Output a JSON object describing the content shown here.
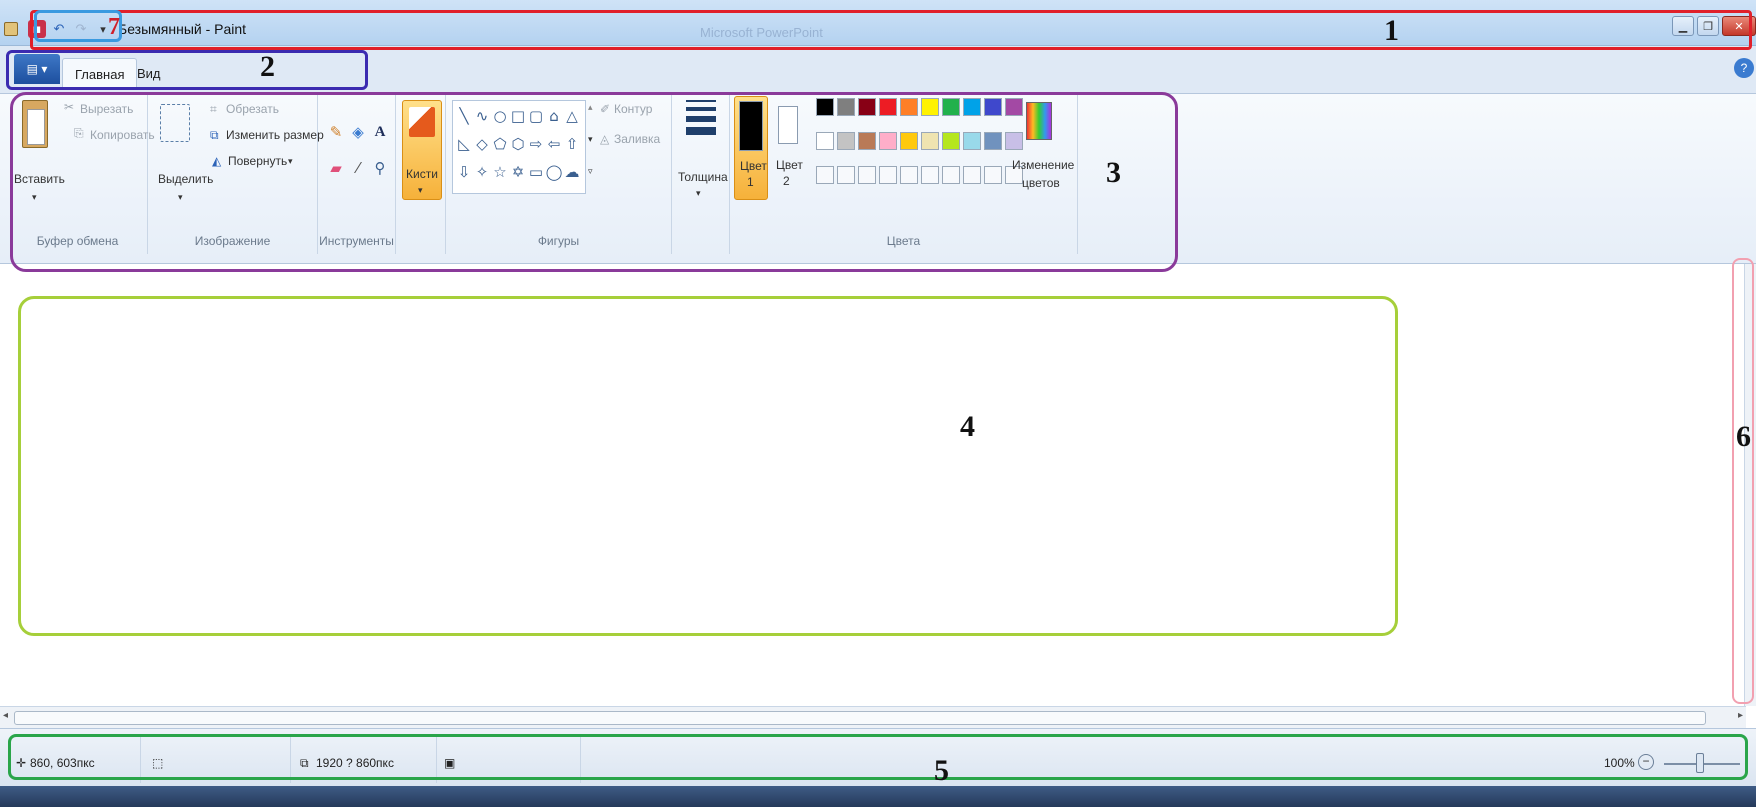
{
  "window": {
    "title": "Безымянный - Paint",
    "ghost_title": "Microsoft PowerPoint"
  },
  "quick_access": {
    "more": "▾"
  },
  "tabs": {
    "file": "▤ ▾",
    "home": "Главная",
    "view": "Вид"
  },
  "ribbon": {
    "clipboard": {
      "paste": "Вставить",
      "cut": "Вырезать",
      "copy": "Копировать",
      "label": "Буфер обмена"
    },
    "image": {
      "select": "Выделить",
      "crop": "Обрезать",
      "resize": "Изменить размер",
      "rotate": "Повернуть",
      "label": "Изображение"
    },
    "tools": {
      "label": "Инструменты",
      "text_tool": "A"
    },
    "brushes": {
      "label": "Кисти"
    },
    "shapes": {
      "outline": "Контур",
      "fill": "Заливка",
      "label": "Фигуры"
    },
    "size": {
      "label": "Толщина"
    },
    "colors": {
      "color1": "Цвет",
      "color1_num": "1",
      "color2": "Цвет",
      "color2_num": "2",
      "edit_colors_line1": "Изменение",
      "edit_colors_line2": "цветов",
      "label": "Цвета",
      "palette_row1": [
        "#000000",
        "#7f7f7f",
        "#880015",
        "#ed1c24",
        "#ff7f27",
        "#fff200",
        "#22b14c",
        "#00a2e8",
        "#3f48cc",
        "#a349a4"
      ],
      "palette_row2": [
        "#ffffff",
        "#c3c3c3",
        "#b97a57",
        "#ffaec9",
        "#ffc90e",
        "#efe4b0",
        "#b5e61d",
        "#99d9ea",
        "#7092be",
        "#c8bfe7"
      ],
      "active_color1": "#000000",
      "active_color2": "#ffffff"
    }
  },
  "status": {
    "cursor_pos": "860, 603пкс",
    "image_size": "1920 ? 860пкс",
    "zoom": "100%",
    "zoom_minus": "−"
  },
  "annotations": {
    "n1": "1",
    "n2": "2",
    "n3": "3",
    "n4": "4",
    "n5": "5",
    "n6": "6",
    "n7": "7",
    "colors": {
      "title_bar": "#e0202a",
      "tabs": "#3b2bb0",
      "ribbon": "#8a3a9a",
      "canvas": "#a6cf3a",
      "status": "#2aa54a",
      "scrollbar": "#f2a0b0",
      "quick_access": "#3a9ae0"
    }
  }
}
